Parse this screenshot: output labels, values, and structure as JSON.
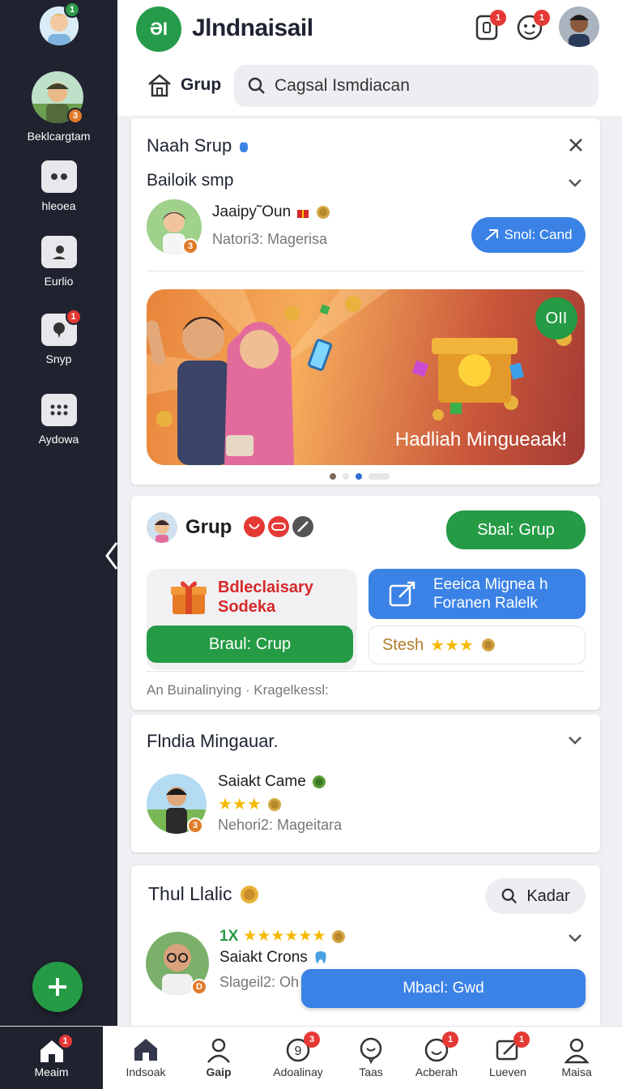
{
  "app": {
    "title": "Jlndnaisail",
    "logo_text": "ƏI"
  },
  "sidebar": {
    "top_badge": "1",
    "profile_label": "Beklcargtam",
    "profile_badge": "3",
    "items": [
      {
        "label": "hleoea",
        "icon": "chat-dots-icon"
      },
      {
        "label": "Eurlio",
        "icon": "person-icon"
      },
      {
        "label": "Snyp",
        "icon": "message-icon",
        "badge": "1"
      },
      {
        "label": "Aydowa",
        "icon": "grid-icon"
      }
    ]
  },
  "header": {
    "notif_badge_1": "1",
    "notif_badge_2": "1",
    "breadcrumb": "Grup",
    "search_placeholder": "Cagsal Ismdiacan"
  },
  "card1": {
    "title": "Naah Srup",
    "subtitle": "Bailoik smp",
    "user_name": "Jaaipy˜Oun",
    "user_meta": "Natori3: Magerisa",
    "avatar_badge": "3",
    "send_button": "Snol: Cand",
    "banner_text": "Hadliah Mingueaak!",
    "banner_badge": "OII",
    "carousel_dots": 4,
    "carousel_active": 2
  },
  "card2": {
    "title": "Grup",
    "join_button": "Sbal: Grup",
    "promo_title_line1": "Bdleclaisary",
    "promo_title_line2": "Sodeka",
    "blue_tile_line1": "Eeeica Mignea h",
    "blue_tile_line2": "Foranen Ralelk",
    "group_button": "Braul: Crup",
    "rating_label": "Stesh",
    "footer_text": "An Buinalinying · Kragelkessl:"
  },
  "card3": {
    "title": "Flndia Mingauar.",
    "user_name": "Saiakt Came",
    "user_meta": "Nehori2: Mageitara",
    "avatar_badge": "3",
    "stars": 3
  },
  "card4": {
    "title": "Thul Llalic",
    "search_button": "Kadar",
    "score_label": "1X",
    "user_name": "Saiakt Crons",
    "user_meta": "Slageil2: Oh",
    "avatar_badge": "D",
    "action_button": "Mbacl: Gwd"
  },
  "bottom_nav": [
    {
      "label": "Meaim",
      "icon": "home-icon",
      "badge": "1"
    },
    {
      "label": "Indsoak",
      "icon": "house-icon"
    },
    {
      "label": "Gaip",
      "icon": "person-icon"
    },
    {
      "label": "Adoalinay",
      "icon": "chat-circle-icon",
      "badge": "3"
    },
    {
      "label": "Taas",
      "icon": "chat-bubble-icon"
    },
    {
      "label": "Acberah",
      "icon": "chat-smile-icon",
      "badge": "1"
    },
    {
      "label": "Lueven",
      "icon": "edit-icon",
      "badge": "1"
    },
    {
      "label": "Maisa",
      "icon": "user-icon"
    }
  ],
  "colors": {
    "sidebar": "#20232f",
    "green": "#259b45",
    "blue": "#3b82e6",
    "badge": "#e53935"
  }
}
